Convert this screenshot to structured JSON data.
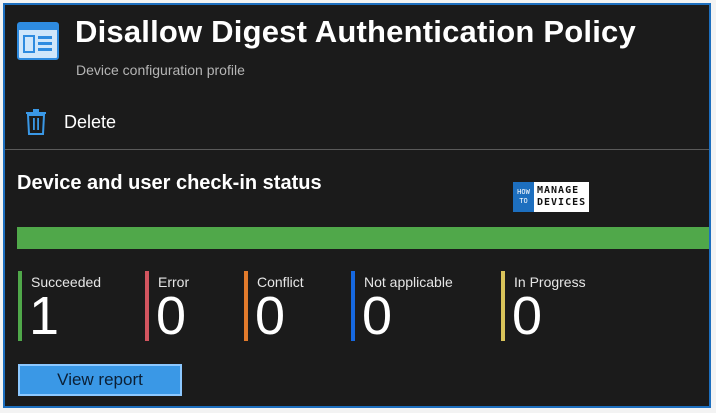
{
  "header": {
    "title": "Disallow Digest Authentication Policy",
    "subtitle": "Device configuration profile",
    "icon": "profile-icon"
  },
  "toolbar": {
    "delete_label": "Delete",
    "delete_icon": "trash-icon"
  },
  "section": {
    "title": "Device and user check-in status"
  },
  "watermark": {
    "small_top": "HOW",
    "small_bottom": "TO",
    "line1": "MANAGE",
    "line2": "DEVICES"
  },
  "progress": {
    "succeeded_fraction": 1.0,
    "color": "#50a84a"
  },
  "stats": [
    {
      "label": "Succeeded",
      "value": "1",
      "color": "#50a84a"
    },
    {
      "label": "Error",
      "value": "0",
      "color": "#d2555f"
    },
    {
      "label": "Conflict",
      "value": "0",
      "color": "#e27b2c"
    },
    {
      "label": "Not applicable",
      "value": "0",
      "color": "#1668e0"
    },
    {
      "label": "In Progress",
      "value": "0",
      "color": "#d9c35a"
    }
  ],
  "actions": {
    "view_report_label": "View report"
  }
}
